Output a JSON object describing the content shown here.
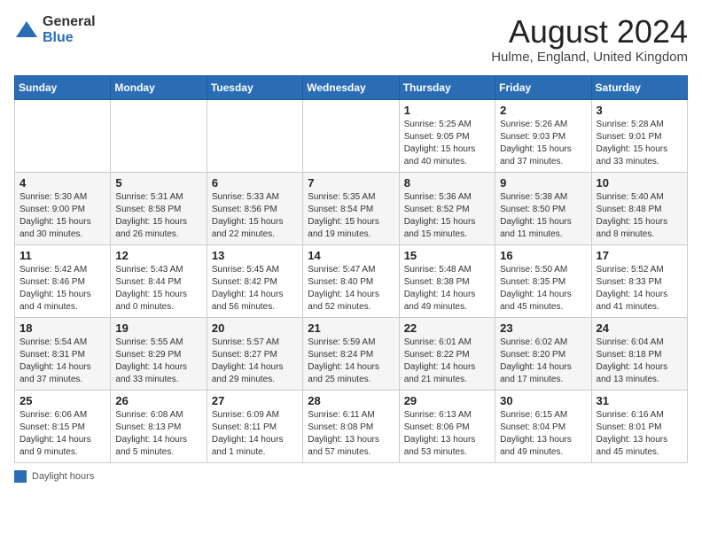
{
  "header": {
    "logo_general": "General",
    "logo_blue": "Blue",
    "month_year": "August 2024",
    "location": "Hulme, England, United Kingdom"
  },
  "days_of_week": [
    "Sunday",
    "Monday",
    "Tuesday",
    "Wednesday",
    "Thursday",
    "Friday",
    "Saturday"
  ],
  "legend": {
    "label": "Daylight hours"
  },
  "weeks": [
    [
      {
        "day": "",
        "info": ""
      },
      {
        "day": "",
        "info": ""
      },
      {
        "day": "",
        "info": ""
      },
      {
        "day": "",
        "info": ""
      },
      {
        "day": "1",
        "info": "Sunrise: 5:25 AM\nSunset: 9:05 PM\nDaylight: 15 hours\nand 40 minutes."
      },
      {
        "day": "2",
        "info": "Sunrise: 5:26 AM\nSunset: 9:03 PM\nDaylight: 15 hours\nand 37 minutes."
      },
      {
        "day": "3",
        "info": "Sunrise: 5:28 AM\nSunset: 9:01 PM\nDaylight: 15 hours\nand 33 minutes."
      }
    ],
    [
      {
        "day": "4",
        "info": "Sunrise: 5:30 AM\nSunset: 9:00 PM\nDaylight: 15 hours\nand 30 minutes."
      },
      {
        "day": "5",
        "info": "Sunrise: 5:31 AM\nSunset: 8:58 PM\nDaylight: 15 hours\nand 26 minutes."
      },
      {
        "day": "6",
        "info": "Sunrise: 5:33 AM\nSunset: 8:56 PM\nDaylight: 15 hours\nand 22 minutes."
      },
      {
        "day": "7",
        "info": "Sunrise: 5:35 AM\nSunset: 8:54 PM\nDaylight: 15 hours\nand 19 minutes."
      },
      {
        "day": "8",
        "info": "Sunrise: 5:36 AM\nSunset: 8:52 PM\nDaylight: 15 hours\nand 15 minutes."
      },
      {
        "day": "9",
        "info": "Sunrise: 5:38 AM\nSunset: 8:50 PM\nDaylight: 15 hours\nand 11 minutes."
      },
      {
        "day": "10",
        "info": "Sunrise: 5:40 AM\nSunset: 8:48 PM\nDaylight: 15 hours\nand 8 minutes."
      }
    ],
    [
      {
        "day": "11",
        "info": "Sunrise: 5:42 AM\nSunset: 8:46 PM\nDaylight: 15 hours\nand 4 minutes."
      },
      {
        "day": "12",
        "info": "Sunrise: 5:43 AM\nSunset: 8:44 PM\nDaylight: 15 hours\nand 0 minutes."
      },
      {
        "day": "13",
        "info": "Sunrise: 5:45 AM\nSunset: 8:42 PM\nDaylight: 14 hours\nand 56 minutes."
      },
      {
        "day": "14",
        "info": "Sunrise: 5:47 AM\nSunset: 8:40 PM\nDaylight: 14 hours\nand 52 minutes."
      },
      {
        "day": "15",
        "info": "Sunrise: 5:48 AM\nSunset: 8:38 PM\nDaylight: 14 hours\nand 49 minutes."
      },
      {
        "day": "16",
        "info": "Sunrise: 5:50 AM\nSunset: 8:35 PM\nDaylight: 14 hours\nand 45 minutes."
      },
      {
        "day": "17",
        "info": "Sunrise: 5:52 AM\nSunset: 8:33 PM\nDaylight: 14 hours\nand 41 minutes."
      }
    ],
    [
      {
        "day": "18",
        "info": "Sunrise: 5:54 AM\nSunset: 8:31 PM\nDaylight: 14 hours\nand 37 minutes."
      },
      {
        "day": "19",
        "info": "Sunrise: 5:55 AM\nSunset: 8:29 PM\nDaylight: 14 hours\nand 33 minutes."
      },
      {
        "day": "20",
        "info": "Sunrise: 5:57 AM\nSunset: 8:27 PM\nDaylight: 14 hours\nand 29 minutes."
      },
      {
        "day": "21",
        "info": "Sunrise: 5:59 AM\nSunset: 8:24 PM\nDaylight: 14 hours\nand 25 minutes."
      },
      {
        "day": "22",
        "info": "Sunrise: 6:01 AM\nSunset: 8:22 PM\nDaylight: 14 hours\nand 21 minutes."
      },
      {
        "day": "23",
        "info": "Sunrise: 6:02 AM\nSunset: 8:20 PM\nDaylight: 14 hours\nand 17 minutes."
      },
      {
        "day": "24",
        "info": "Sunrise: 6:04 AM\nSunset: 8:18 PM\nDaylight: 14 hours\nand 13 minutes."
      }
    ],
    [
      {
        "day": "25",
        "info": "Sunrise: 6:06 AM\nSunset: 8:15 PM\nDaylight: 14 hours\nand 9 minutes."
      },
      {
        "day": "26",
        "info": "Sunrise: 6:08 AM\nSunset: 8:13 PM\nDaylight: 14 hours\nand 5 minutes."
      },
      {
        "day": "27",
        "info": "Sunrise: 6:09 AM\nSunset: 8:11 PM\nDaylight: 14 hours\nand 1 minute."
      },
      {
        "day": "28",
        "info": "Sunrise: 6:11 AM\nSunset: 8:08 PM\nDaylight: 13 hours\nand 57 minutes."
      },
      {
        "day": "29",
        "info": "Sunrise: 6:13 AM\nSunset: 8:06 PM\nDaylight: 13 hours\nand 53 minutes."
      },
      {
        "day": "30",
        "info": "Sunrise: 6:15 AM\nSunset: 8:04 PM\nDaylight: 13 hours\nand 49 minutes."
      },
      {
        "day": "31",
        "info": "Sunrise: 6:16 AM\nSunset: 8:01 PM\nDaylight: 13 hours\nand 45 minutes."
      }
    ]
  ]
}
